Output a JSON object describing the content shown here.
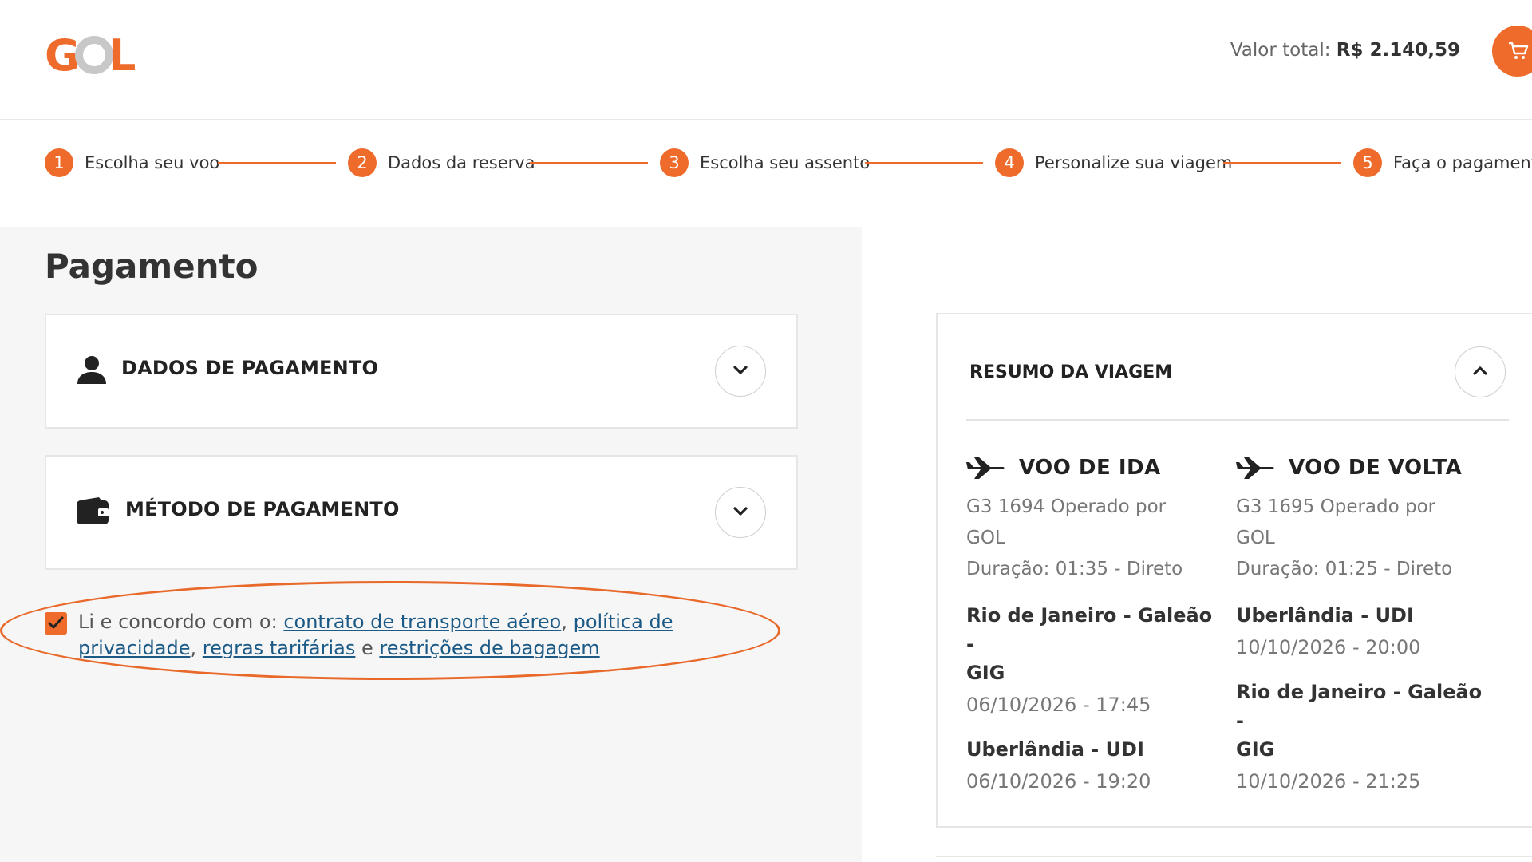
{
  "header": {
    "logo_text": "GOL",
    "total_label": "Valor total:",
    "total_value": "R$ 2.140,59",
    "cart_icon": "cart-icon",
    "brand_color": "#ee6b2c"
  },
  "stepper": {
    "steps": [
      {
        "num": "1",
        "label": "Escolha seu voo"
      },
      {
        "num": "2",
        "label": "Dados da reserva"
      },
      {
        "num": "3",
        "label": "Escolha seu assento"
      },
      {
        "num": "4",
        "label": "Personalize sua viagem"
      },
      {
        "num": "5",
        "label": "Faça o pagamento"
      }
    ]
  },
  "main": {
    "title": "Pagamento",
    "accordions": [
      {
        "title": "DADOS DE PAGAMENTO",
        "icon": "person-icon"
      },
      {
        "title": "MÉTODO DE PAGAMENTO",
        "icon": "wallet-icon"
      }
    ],
    "agreement": {
      "checked": true,
      "prefix": "Li e concordo com o:",
      "link1": "contrato de transporte aéreo",
      "sep1": ",",
      "link2": "política de privacidade",
      "sep2": ",",
      "link3": "regras tarifárias",
      "conj": "e",
      "link4": "restrições de bagagem"
    }
  },
  "summary": {
    "title": "RESUMO DA VIAGEM",
    "outbound": {
      "heading": "VOO DE IDA",
      "flight_line1": "G3 1694 Operado por",
      "flight_line2": "GOL",
      "duration": "Duração: 01:35 - Direto",
      "from_city_line1": "Rio de Janeiro - Galeão -",
      "from_city_line2": "GIG",
      "from_dt": "06/10/2026 - 17:45",
      "to_city": "Uberlândia - UDI",
      "to_dt": "06/10/2026 - 19:20"
    },
    "return": {
      "heading": "VOO DE VOLTA",
      "flight_line1": "G3 1695 Operado por",
      "flight_line2": "GOL",
      "duration": "Duração: 01:25 - Direto",
      "from_city": "Uberlândia - UDI",
      "from_dt": "10/10/2026 - 20:00",
      "to_city_line1": "Rio de Janeiro - Galeão -",
      "to_city_line2": "GIG",
      "to_dt": "10/10/2026 - 21:25"
    }
  }
}
